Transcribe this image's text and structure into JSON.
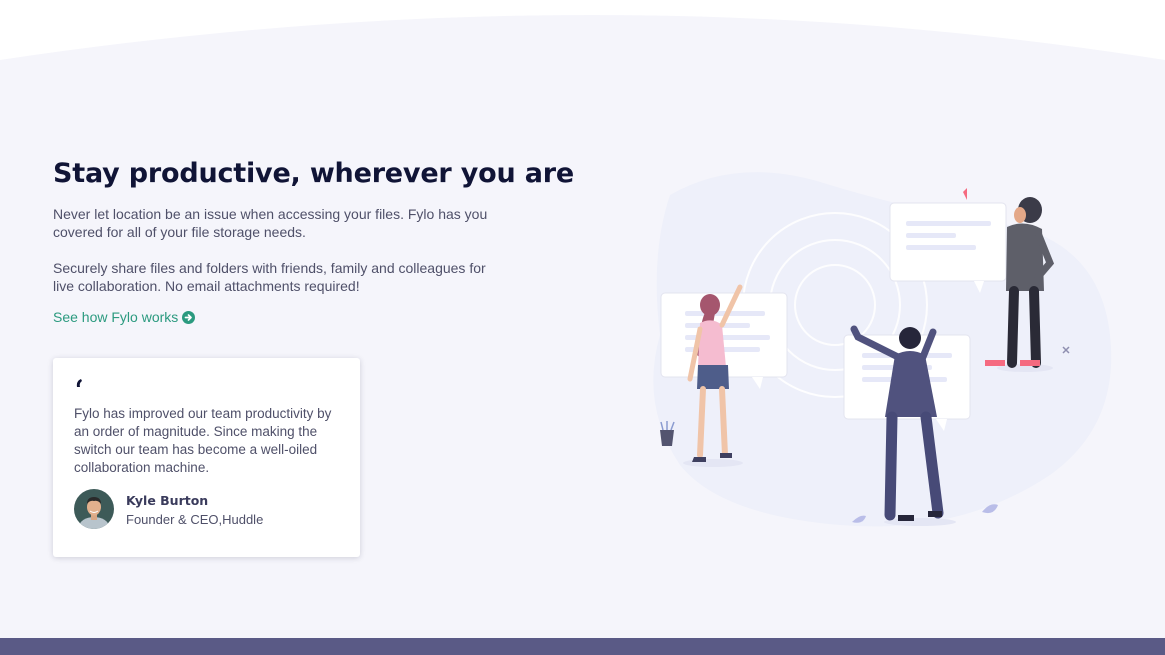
{
  "section": {
    "title": "Stay productive, wherever you are",
    "paragraph_1": "Never let location be an issue when accessing your files. Fylo has you covered for all of your file storage needs.",
    "paragraph_2": "Securely share files and folders with friends, family and colleagues for live collaboration. No email attachments required!",
    "link_label": "See how Fylo works",
    "link_icon": "arrow-circle-right-icon"
  },
  "testimonial": {
    "quote_icon": "quote-icon",
    "quote": "Fylo has improved our team productivity by an order of magnitude. Since making the switch our team has become a well-oiled collaboration machine.",
    "author_name": "Kyle Burton",
    "author_role": "Founder & CEO,Huddle"
  },
  "colors": {
    "background": "#f5f5fb",
    "heading": "#101436",
    "body_text": "#4f5069",
    "link": "#2b9a7f",
    "footer_band": "#5a5a86",
    "card": "#ffffff"
  }
}
